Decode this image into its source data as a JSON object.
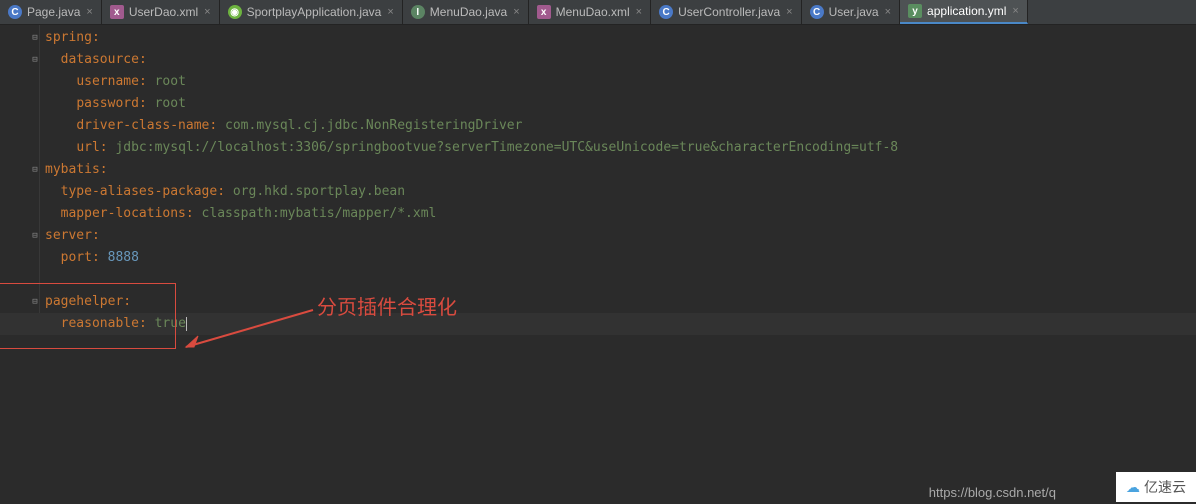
{
  "tabs": [
    {
      "label": "Page.java",
      "icon": "C",
      "iconClass": "ic-java"
    },
    {
      "label": "UserDao.xml",
      "icon": "x",
      "iconClass": "ic-xml"
    },
    {
      "label": "SportplayApplication.java",
      "icon": "◉",
      "iconClass": "ic-spring"
    },
    {
      "label": "MenuDao.java",
      "icon": "I",
      "iconClass": "ic-interface"
    },
    {
      "label": "MenuDao.xml",
      "icon": "x",
      "iconClass": "ic-xml"
    },
    {
      "label": "UserController.java",
      "icon": "C",
      "iconClass": "ic-java"
    },
    {
      "label": "User.java",
      "icon": "C",
      "iconClass": "ic-java"
    },
    {
      "label": "application.yml",
      "icon": "y",
      "iconClass": "ic-yml",
      "active": true
    }
  ],
  "code": {
    "spring": "spring",
    "datasource": "datasource",
    "username": "username",
    "username_val": "root",
    "password": "password",
    "password_val": "root",
    "driver": "driver-class-name",
    "driver_val": "com.mysql.cj.jdbc.NonRegisteringDriver",
    "url": "url",
    "url_val": "jdbc:mysql://localhost:3306/springbootvue?serverTimezone=UTC&useUnicode=true&characterEncoding=utf-8",
    "mybatis": "mybatis",
    "type_aliases": "type-aliases-package",
    "type_aliases_val": "org.hkd.sportplay.bean",
    "mapper_loc": "mapper-locations",
    "mapper_loc_val": "classpath:mybatis/mapper/*.xml",
    "server": "server",
    "port": "port",
    "port_val": "8888",
    "pagehelper": "pagehelper",
    "reasonable": "reasonable",
    "reasonable_val": "true"
  },
  "annotation": "分页插件合理化",
  "watermark_url": "https://blog.csdn.net/q",
  "watermark_brand": "亿速云"
}
